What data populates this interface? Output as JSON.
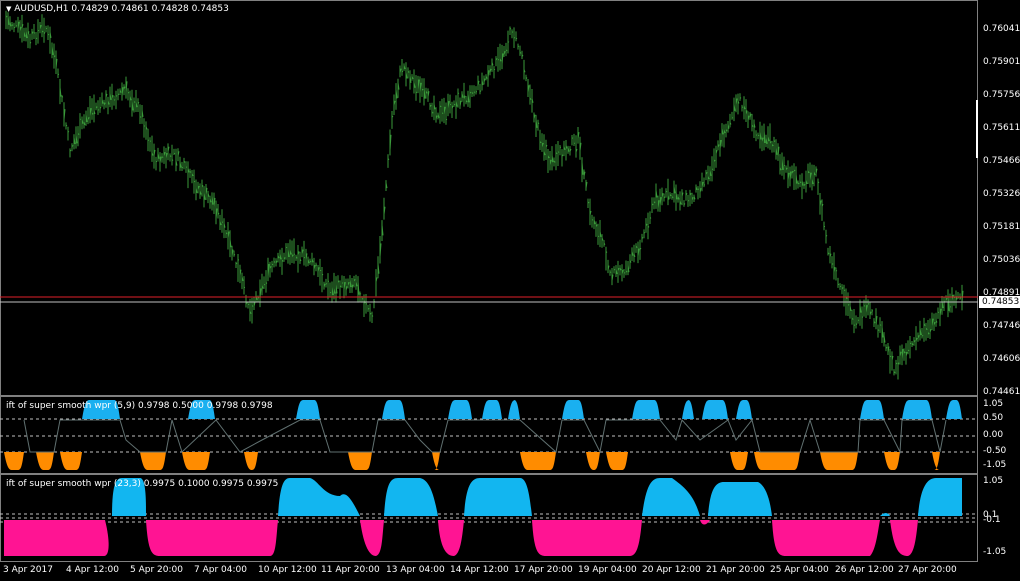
{
  "main_chart": {
    "symbol_label": "AUDUSD,H1",
    "ohlc_label": "0.74829 0.74861 0.74828 0.74853",
    "current_price": "0.74853",
    "colors": {
      "bars": "#3a9a3a",
      "bid_line": "#c0c0c0",
      "ask_line": "#e0202a",
      "frame": "#808080"
    },
    "price_axis": [
      "0.76041",
      "0.75901",
      "0.75756",
      "0.75611",
      "0.75466",
      "0.75326",
      "0.75181",
      "0.75036",
      "0.74891",
      "0.74746",
      "0.74606",
      "0.74461"
    ]
  },
  "indicator1": {
    "title": "ift of super smooth wpr (5,9) 0.9798 0.5000 0.9798 0.9798",
    "colors": {
      "up": "#1ab0f0",
      "down": "#ff8c00",
      "line": "#607070"
    },
    "levels": [
      "1.05",
      "0.50",
      "0.00",
      "-0.50",
      "-1.05"
    ]
  },
  "indicator2": {
    "title": "ift of super smooth wpr (23,3) 0.9975 0.1000 0.9975 0.9975",
    "colors": {
      "up": "#12b6f0",
      "down": "#ff1493"
    },
    "levels": [
      "1.05",
      "0.1",
      "-0.1",
      "-1.05"
    ]
  },
  "time_axis": [
    "3 Apr 2017",
    "4 Apr 12:00",
    "5 Apr 20:00",
    "7 Apr 04:00",
    "10 Apr 12:00",
    "11 Apr 20:00",
    "13 Apr 04:00",
    "14 Apr 12:00",
    "17 Apr 20:00",
    "19 Apr 04:00",
    "20 Apr 12:00",
    "21 Apr 20:00",
    "25 Apr 04:00",
    "26 Apr 12:00",
    "27 Apr 20:00"
  ]
}
